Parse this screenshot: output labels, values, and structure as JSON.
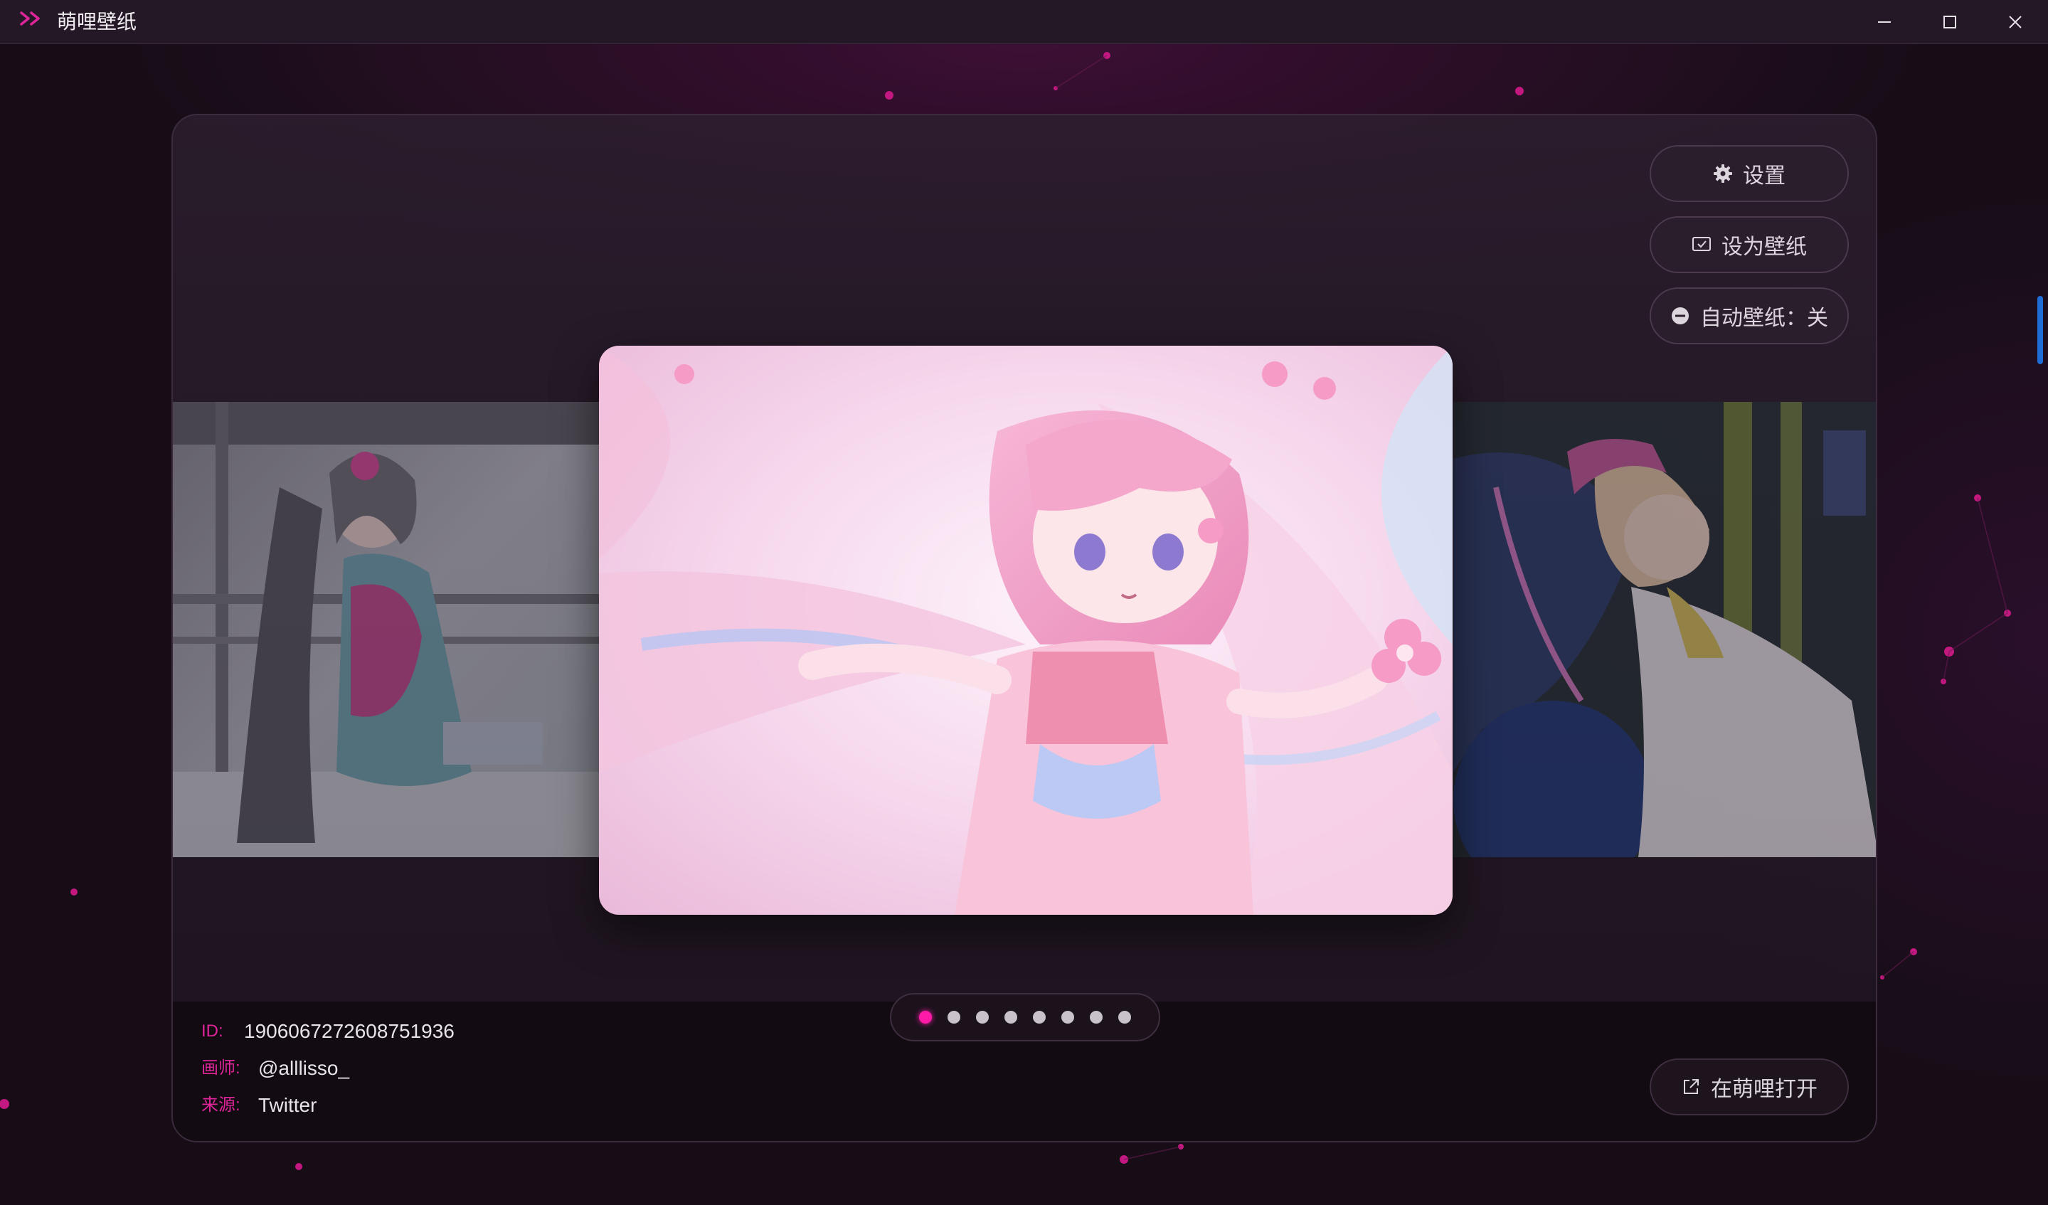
{
  "window": {
    "title": "萌哩壁纸",
    "controls": [
      "minimize-icon",
      "maximize-icon",
      "close-icon"
    ]
  },
  "actions": {
    "settings_label": "设置",
    "set_wallpaper_label": "设为壁纸",
    "auto_wallpaper_label": "自动壁纸：关"
  },
  "info": {
    "id_key": "ID:",
    "id_value": "1906067272608751936",
    "artist_key": "画师:",
    "artist_value": "@alllisso_",
    "source_key": "来源:",
    "source_value": "Twitter"
  },
  "pager": {
    "count": 8,
    "active_index": 0
  },
  "open_button_label": "在萌哩打开",
  "colors": {
    "accent": "#ff1aa8",
    "background": "#170d17",
    "titlebar": "#251826"
  }
}
